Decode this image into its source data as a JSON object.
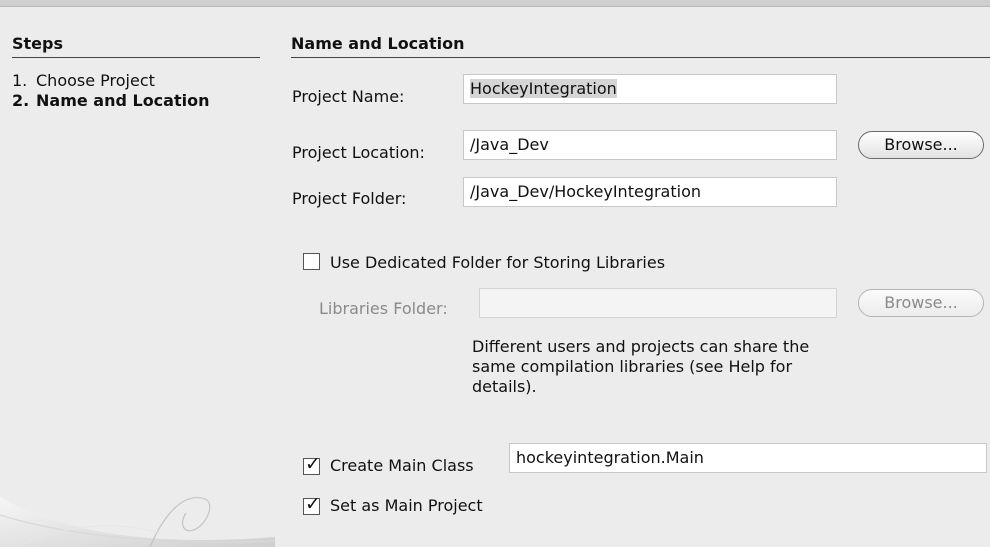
{
  "steps": {
    "title": "Steps",
    "items": [
      {
        "number": "1.",
        "label": "Choose Project"
      },
      {
        "number": "2.",
        "label": "Name and Location"
      }
    ]
  },
  "section": {
    "title": "Name and Location"
  },
  "project_name": {
    "label": "Project Name:",
    "value": "HockeyIntegration"
  },
  "project_location": {
    "label": "Project Location:",
    "value": "/Java_Dev",
    "browse_label": "Browse..."
  },
  "project_folder": {
    "label": "Project Folder:",
    "value": "/Java_Dev/HockeyIntegration"
  },
  "dedicated_folder": {
    "label": "Use Dedicated Folder for Storing Libraries",
    "checked": false
  },
  "libraries_folder": {
    "label": "Libraries Folder:",
    "value": "",
    "browse_label": "Browse..."
  },
  "help": {
    "text": "Different users and projects can share the same compilation libraries (see Help for details)."
  },
  "main_class": {
    "label": "Create Main Class",
    "value": "hockeyintegration.Main",
    "checked": true
  },
  "main_project": {
    "label": "Set as Main Project",
    "checked": true
  }
}
